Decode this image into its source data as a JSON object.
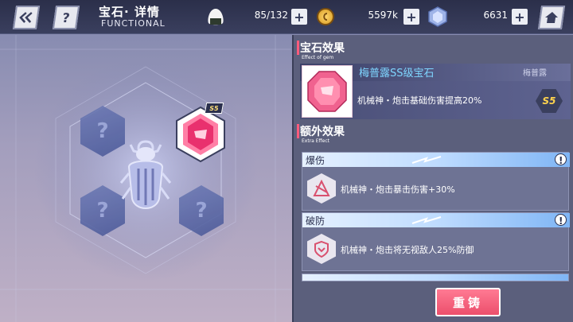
{
  "header": {
    "title": "宝石· 详情",
    "subtitle": "FUNCTIONAL",
    "help_glyph": "?",
    "stamina": "85/132",
    "coins": "5597k",
    "crystals": "6631",
    "plus_glyph": "+"
  },
  "left": {
    "locked_glyph": "?",
    "gem_badge": "S5"
  },
  "gem_effect": {
    "heading": "宝石效果",
    "heading_en": "Effect of gem",
    "gem_name": "梅普露SS级宝石",
    "owner": "梅普露",
    "description": "机械神・炮击基础伤害提高20%",
    "grade_badge": "S5"
  },
  "extra_effect": {
    "heading": "额外效果",
    "heading_en": "Extra Effect",
    "items": [
      {
        "title": "爆伤",
        "description": "机械神・炮击暴击伤害+30%",
        "info": "!"
      },
      {
        "title": "破防",
        "description": "机械神・炮击将无视敌人25%防御",
        "info": "!"
      }
    ]
  },
  "reforge_label": "重铸",
  "colors": {
    "accent_pink": "#ec4f6c",
    "panel": "#5b5f7c",
    "header_blue": "#7fb5f5"
  }
}
